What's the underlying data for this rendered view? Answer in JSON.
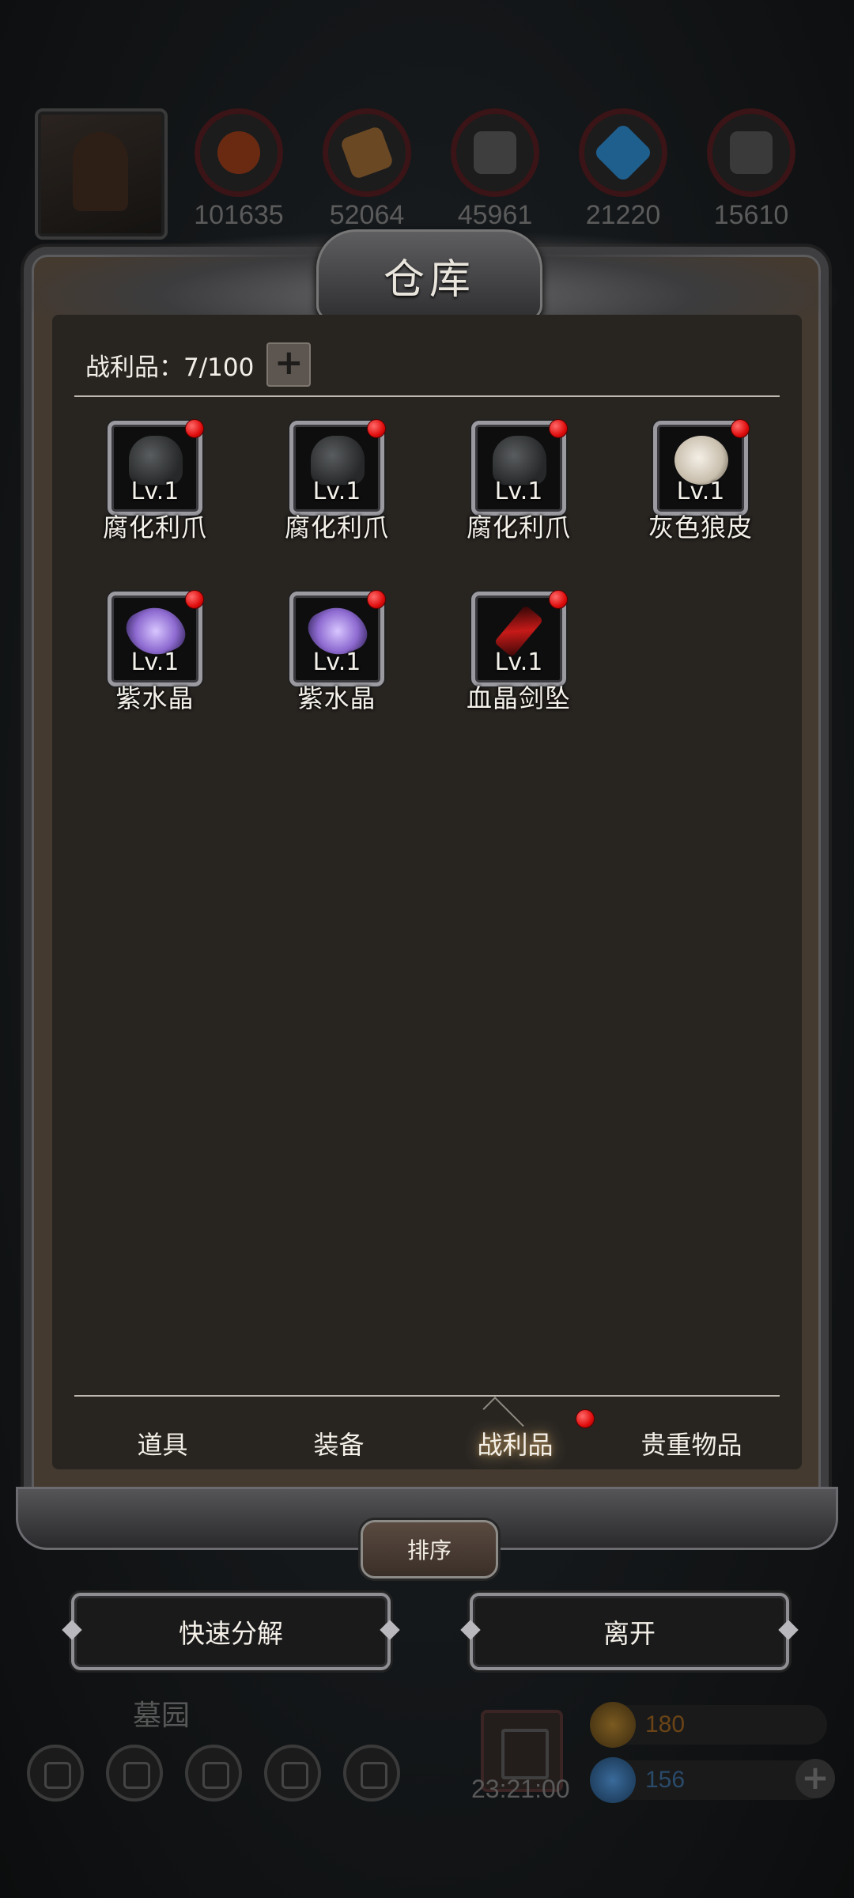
{
  "resources": [
    {
      "name": "meat-icon",
      "value": "101635",
      "color": "#8a3a18"
    },
    {
      "name": "wood-icon",
      "value": "52064",
      "color": "#8a5a2a"
    },
    {
      "name": "stone-icon",
      "value": "45961",
      "color": "#505050"
    },
    {
      "name": "crystal-icon",
      "value": "21220",
      "color": "#2a7ab8"
    },
    {
      "name": "iron-icon",
      "value": "15610",
      "color": "#4a4a4a"
    }
  ],
  "panel": {
    "title": "仓库",
    "loot_label": "战利品：7/100",
    "expand_label": "+"
  },
  "items": [
    {
      "level": "Lv.1",
      "name": "腐化利爪",
      "icon": "claw-icon",
      "new": true
    },
    {
      "level": "Lv.1",
      "name": "腐化利爪",
      "icon": "claw-icon",
      "new": true
    },
    {
      "level": "Lv.1",
      "name": "腐化利爪",
      "icon": "claw-icon",
      "new": true
    },
    {
      "level": "Lv.1",
      "name": "灰色狼皮",
      "icon": "fur-icon",
      "new": true
    },
    {
      "level": "Lv.1",
      "name": "紫水晶",
      "icon": "crystal-icon",
      "new": true
    },
    {
      "level": "Lv.1",
      "name": "紫水晶",
      "icon": "crystal-icon",
      "new": true
    },
    {
      "level": "Lv.1",
      "name": "血晶剑坠",
      "icon": "pendant-icon",
      "new": true
    }
  ],
  "tabs": [
    {
      "label": "道具",
      "active": false
    },
    {
      "label": "装备",
      "active": false
    },
    {
      "label": "战利品",
      "active": true,
      "badge": true
    },
    {
      "label": "贵重物品",
      "active": false
    }
  ],
  "buttons": {
    "sort": "排序",
    "quick_decompose": "快速分解",
    "leave": "离开"
  },
  "hud": {
    "location": "墓园",
    "timer": "23:21:00",
    "gold": "180",
    "gems": "156",
    "gold_color": "#8a5a1a",
    "gem_color": "#2a5a8a"
  }
}
